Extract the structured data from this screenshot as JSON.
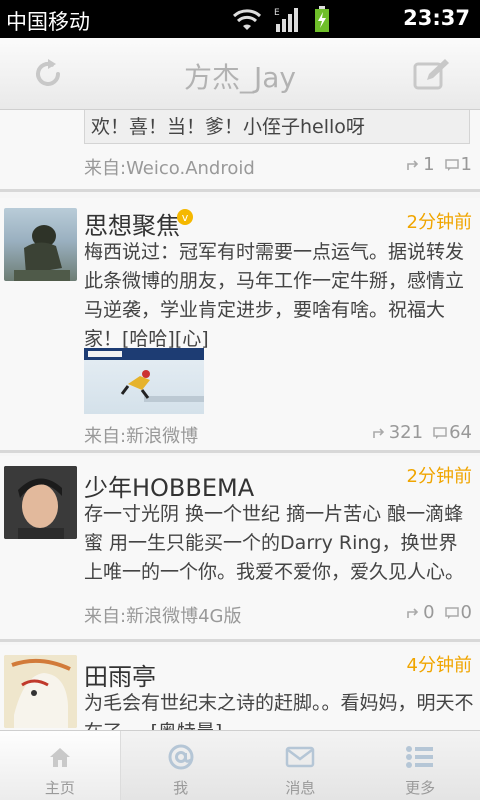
{
  "status_bar": {
    "carrier": "中国移动",
    "time": "23:37"
  },
  "header": {
    "title": "方杰_Jay"
  },
  "posts": [
    {
      "quote": "欢！喜！当！爹！小侄子hello呀",
      "source": "来自:Weico.Android",
      "reposts": "1",
      "comments": "1"
    },
    {
      "name": "思想聚焦",
      "verified": true,
      "time": "2分钟前",
      "text": "梅西说过：冠军有时需要一点运气。据说转发此条微博的朋友，马年工作一定牛掰，感情立马逆袭，学业肯定进步，要啥有啥。祝福大家！[哈哈][心]",
      "source": "来自:新浪微博",
      "reposts": "321",
      "comments": "64"
    },
    {
      "name": "少年HOBBEMA",
      "time": "2分钟前",
      "text": "存一寸光阴 换一个世纪 摘一片苦心 酿一滴蜂蜜 用一生只能买一个的Darry Ring，换世界上唯一的一个你。我爱不爱你，爱久见人心。",
      "source": "来自:新浪微博4G版",
      "reposts": "0",
      "comments": "0"
    },
    {
      "name": "田雨亭",
      "time": "4分钟前",
      "text": "为毛会有世纪末之诗的赶脚。。看妈妈，明天不在了。。[奥特曼]"
    }
  ],
  "tabs": [
    {
      "label": "主页",
      "icon": "home-icon"
    },
    {
      "label": "我",
      "icon": "at-icon"
    },
    {
      "label": "消息",
      "icon": "envelope-icon"
    },
    {
      "label": "更多",
      "icon": "list-icon"
    }
  ],
  "colors": {
    "time_accent": "#f0a500",
    "verified_badge": "#f5b800"
  }
}
